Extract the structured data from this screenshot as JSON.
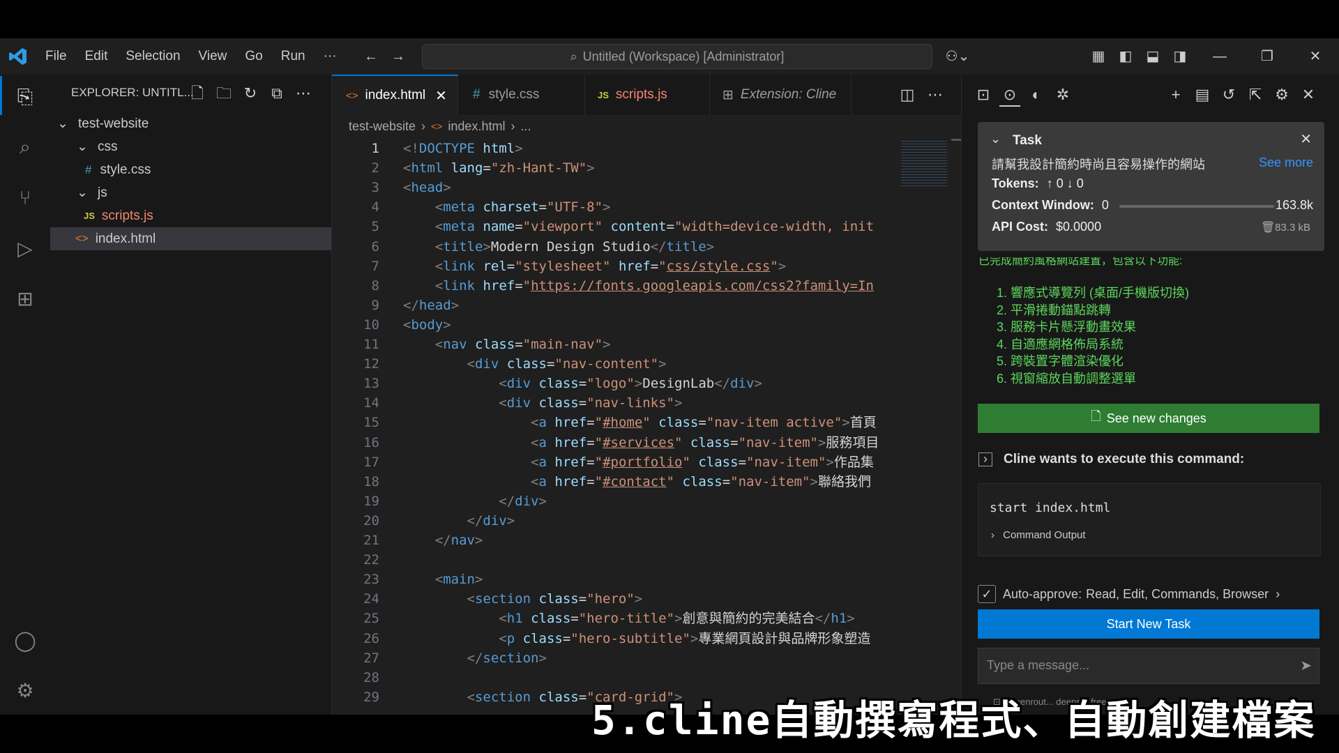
{
  "menu": [
    "File",
    "Edit",
    "Selection",
    "View",
    "Go",
    "Run",
    "···"
  ],
  "command_center": "Untitled (Workspace) [Administrator]",
  "explorer": {
    "title": "EXPLORER: UNTITL...",
    "tree": [
      {
        "label": "test-website",
        "kind": "folder"
      },
      {
        "label": "css",
        "kind": "folder"
      },
      {
        "label": "style.css",
        "kind": "css"
      },
      {
        "label": "js",
        "kind": "folder"
      },
      {
        "label": "scripts.js",
        "kind": "js"
      },
      {
        "label": "index.html",
        "kind": "html"
      }
    ]
  },
  "tabs": [
    {
      "label": "index.html",
      "active": true
    },
    {
      "label": "style.css"
    },
    {
      "label": "scripts.js"
    },
    {
      "label": "Extension: Cline"
    }
  ],
  "breadcrumb": {
    "folder": "test-website",
    "file": "index.html",
    "rest": "..."
  },
  "code": [
    [
      {
        "c": "tg",
        "t": "<!"
      },
      {
        "c": "tn",
        "t": "DOCTYPE"
      },
      {
        "c": "tx",
        "t": " "
      },
      {
        "c": "at",
        "t": "html"
      },
      {
        "c": "tg",
        "t": ">"
      }
    ],
    [
      {
        "c": "tg",
        "t": "<"
      },
      {
        "c": "tn",
        "t": "html"
      },
      {
        "c": "tx",
        "t": " "
      },
      {
        "c": "at",
        "t": "lang"
      },
      {
        "c": "tx",
        "t": "="
      },
      {
        "c": "st",
        "t": "\"zh-Hant-TW\""
      },
      {
        "c": "tg",
        "t": ">"
      }
    ],
    [
      {
        "c": "tg",
        "t": "<"
      },
      {
        "c": "tn",
        "t": "head"
      },
      {
        "c": "tg",
        "t": ">"
      }
    ],
    [
      {
        "c": "tx",
        "t": "    "
      },
      {
        "c": "tg",
        "t": "<"
      },
      {
        "c": "tn",
        "t": "meta"
      },
      {
        "c": "tx",
        "t": " "
      },
      {
        "c": "at",
        "t": "charset"
      },
      {
        "c": "tx",
        "t": "="
      },
      {
        "c": "st",
        "t": "\"UTF-8\""
      },
      {
        "c": "tg",
        "t": ">"
      }
    ],
    [
      {
        "c": "tx",
        "t": "    "
      },
      {
        "c": "tg",
        "t": "<"
      },
      {
        "c": "tn",
        "t": "meta"
      },
      {
        "c": "tx",
        "t": " "
      },
      {
        "c": "at",
        "t": "name"
      },
      {
        "c": "tx",
        "t": "="
      },
      {
        "c": "st",
        "t": "\"viewport\""
      },
      {
        "c": "tx",
        "t": " "
      },
      {
        "c": "at",
        "t": "content"
      },
      {
        "c": "tx",
        "t": "="
      },
      {
        "c": "st",
        "t": "\"width=device-width, init"
      }
    ],
    [
      {
        "c": "tx",
        "t": "    "
      },
      {
        "c": "tg",
        "t": "<"
      },
      {
        "c": "tn",
        "t": "title"
      },
      {
        "c": "tg",
        "t": ">"
      },
      {
        "c": "tx",
        "t": "Modern Design Studio"
      },
      {
        "c": "tg",
        "t": "</"
      },
      {
        "c": "tn",
        "t": "title"
      },
      {
        "c": "tg",
        "t": ">"
      }
    ],
    [
      {
        "c": "tx",
        "t": "    "
      },
      {
        "c": "tg",
        "t": "<"
      },
      {
        "c": "tn",
        "t": "link"
      },
      {
        "c": "tx",
        "t": " "
      },
      {
        "c": "at",
        "t": "rel"
      },
      {
        "c": "tx",
        "t": "="
      },
      {
        "c": "st",
        "t": "\"stylesheet\""
      },
      {
        "c": "tx",
        "t": " "
      },
      {
        "c": "at",
        "t": "href"
      },
      {
        "c": "tx",
        "t": "="
      },
      {
        "c": "st",
        "t": "\""
      },
      {
        "c": "st ul",
        "t": "css/style.css"
      },
      {
        "c": "st",
        "t": "\""
      },
      {
        "c": "tg",
        "t": ">"
      }
    ],
    [
      {
        "c": "tx",
        "t": "    "
      },
      {
        "c": "tg",
        "t": "<"
      },
      {
        "c": "tn",
        "t": "link"
      },
      {
        "c": "tx",
        "t": " "
      },
      {
        "c": "at",
        "t": "href"
      },
      {
        "c": "tx",
        "t": "="
      },
      {
        "c": "st",
        "t": "\""
      },
      {
        "c": "st ul",
        "t": "https://fonts.googleapis.com/css2?family=In"
      }
    ],
    [
      {
        "c": "tg",
        "t": "</"
      },
      {
        "c": "tn",
        "t": "head"
      },
      {
        "c": "tg",
        "t": ">"
      }
    ],
    [
      {
        "c": "tg",
        "t": "<"
      },
      {
        "c": "tn",
        "t": "body"
      },
      {
        "c": "tg",
        "t": ">"
      }
    ],
    [
      {
        "c": "tx",
        "t": "    "
      },
      {
        "c": "tg",
        "t": "<"
      },
      {
        "c": "tn",
        "t": "nav"
      },
      {
        "c": "tx",
        "t": " "
      },
      {
        "c": "at",
        "t": "class"
      },
      {
        "c": "tx",
        "t": "="
      },
      {
        "c": "st",
        "t": "\"main-nav\""
      },
      {
        "c": "tg",
        "t": ">"
      }
    ],
    [
      {
        "c": "tx",
        "t": "        "
      },
      {
        "c": "tg",
        "t": "<"
      },
      {
        "c": "tn",
        "t": "div"
      },
      {
        "c": "tx",
        "t": " "
      },
      {
        "c": "at",
        "t": "class"
      },
      {
        "c": "tx",
        "t": "="
      },
      {
        "c": "st",
        "t": "\"nav-content\""
      },
      {
        "c": "tg",
        "t": ">"
      }
    ],
    [
      {
        "c": "tx",
        "t": "            "
      },
      {
        "c": "tg",
        "t": "<"
      },
      {
        "c": "tn",
        "t": "div"
      },
      {
        "c": "tx",
        "t": " "
      },
      {
        "c": "at",
        "t": "class"
      },
      {
        "c": "tx",
        "t": "="
      },
      {
        "c": "st",
        "t": "\"logo\""
      },
      {
        "c": "tg",
        "t": ">"
      },
      {
        "c": "tx",
        "t": "DesignLab"
      },
      {
        "c": "tg",
        "t": "</"
      },
      {
        "c": "tn",
        "t": "div"
      },
      {
        "c": "tg",
        "t": ">"
      }
    ],
    [
      {
        "c": "tx",
        "t": "            "
      },
      {
        "c": "tg",
        "t": "<"
      },
      {
        "c": "tn",
        "t": "div"
      },
      {
        "c": "tx",
        "t": " "
      },
      {
        "c": "at",
        "t": "class"
      },
      {
        "c": "tx",
        "t": "="
      },
      {
        "c": "st",
        "t": "\"nav-links\""
      },
      {
        "c": "tg",
        "t": ">"
      }
    ],
    [
      {
        "c": "tx",
        "t": "                "
      },
      {
        "c": "tg",
        "t": "<"
      },
      {
        "c": "tn",
        "t": "a"
      },
      {
        "c": "tx",
        "t": " "
      },
      {
        "c": "at",
        "t": "href"
      },
      {
        "c": "tx",
        "t": "="
      },
      {
        "c": "st",
        "t": "\""
      },
      {
        "c": "st ul",
        "t": "#home"
      },
      {
        "c": "st",
        "t": "\""
      },
      {
        "c": "tx",
        "t": " "
      },
      {
        "c": "at",
        "t": "class"
      },
      {
        "c": "tx",
        "t": "="
      },
      {
        "c": "st",
        "t": "\"nav-item active\""
      },
      {
        "c": "tg",
        "t": ">"
      },
      {
        "c": "tx",
        "t": "首頁"
      }
    ],
    [
      {
        "c": "tx",
        "t": "                "
      },
      {
        "c": "tg",
        "t": "<"
      },
      {
        "c": "tn",
        "t": "a"
      },
      {
        "c": "tx",
        "t": " "
      },
      {
        "c": "at",
        "t": "href"
      },
      {
        "c": "tx",
        "t": "="
      },
      {
        "c": "st",
        "t": "\""
      },
      {
        "c": "st ul",
        "t": "#services"
      },
      {
        "c": "st",
        "t": "\""
      },
      {
        "c": "tx",
        "t": " "
      },
      {
        "c": "at",
        "t": "class"
      },
      {
        "c": "tx",
        "t": "="
      },
      {
        "c": "st",
        "t": "\"nav-item\""
      },
      {
        "c": "tg",
        "t": ">"
      },
      {
        "c": "tx",
        "t": "服務項目"
      }
    ],
    [
      {
        "c": "tx",
        "t": "                "
      },
      {
        "c": "tg",
        "t": "<"
      },
      {
        "c": "tn",
        "t": "a"
      },
      {
        "c": "tx",
        "t": " "
      },
      {
        "c": "at",
        "t": "href"
      },
      {
        "c": "tx",
        "t": "="
      },
      {
        "c": "st",
        "t": "\""
      },
      {
        "c": "st ul",
        "t": "#portfolio"
      },
      {
        "c": "st",
        "t": "\""
      },
      {
        "c": "tx",
        "t": " "
      },
      {
        "c": "at",
        "t": "class"
      },
      {
        "c": "tx",
        "t": "="
      },
      {
        "c": "st",
        "t": "\"nav-item\""
      },
      {
        "c": "tg",
        "t": ">"
      },
      {
        "c": "tx",
        "t": "作品集"
      }
    ],
    [
      {
        "c": "tx",
        "t": "                "
      },
      {
        "c": "tg",
        "t": "<"
      },
      {
        "c": "tn",
        "t": "a"
      },
      {
        "c": "tx",
        "t": " "
      },
      {
        "c": "at",
        "t": "href"
      },
      {
        "c": "tx",
        "t": "="
      },
      {
        "c": "st",
        "t": "\""
      },
      {
        "c": "st ul",
        "t": "#contact"
      },
      {
        "c": "st",
        "t": "\""
      },
      {
        "c": "tx",
        "t": " "
      },
      {
        "c": "at",
        "t": "class"
      },
      {
        "c": "tx",
        "t": "="
      },
      {
        "c": "st",
        "t": "\"nav-item\""
      },
      {
        "c": "tg",
        "t": ">"
      },
      {
        "c": "tx",
        "t": "聯絡我們"
      }
    ],
    [
      {
        "c": "tx",
        "t": "            "
      },
      {
        "c": "tg",
        "t": "</"
      },
      {
        "c": "tn",
        "t": "div"
      },
      {
        "c": "tg",
        "t": ">"
      }
    ],
    [
      {
        "c": "tx",
        "t": "        "
      },
      {
        "c": "tg",
        "t": "</"
      },
      {
        "c": "tn",
        "t": "div"
      },
      {
        "c": "tg",
        "t": ">"
      }
    ],
    [
      {
        "c": "tx",
        "t": "    "
      },
      {
        "c": "tg",
        "t": "</"
      },
      {
        "c": "tn",
        "t": "nav"
      },
      {
        "c": "tg",
        "t": ">"
      }
    ],
    [],
    [
      {
        "c": "tx",
        "t": "    "
      },
      {
        "c": "tg",
        "t": "<"
      },
      {
        "c": "tn",
        "t": "main"
      },
      {
        "c": "tg",
        "t": ">"
      }
    ],
    [
      {
        "c": "tx",
        "t": "        "
      },
      {
        "c": "tg",
        "t": "<"
      },
      {
        "c": "tn",
        "t": "section"
      },
      {
        "c": "tx",
        "t": " "
      },
      {
        "c": "at",
        "t": "class"
      },
      {
        "c": "tx",
        "t": "="
      },
      {
        "c": "st",
        "t": "\"hero\""
      },
      {
        "c": "tg",
        "t": ">"
      }
    ],
    [
      {
        "c": "tx",
        "t": "            "
      },
      {
        "c": "tg",
        "t": "<"
      },
      {
        "c": "tn",
        "t": "h1"
      },
      {
        "c": "tx",
        "t": " "
      },
      {
        "c": "at",
        "t": "class"
      },
      {
        "c": "tx",
        "t": "="
      },
      {
        "c": "st",
        "t": "\"hero-title\""
      },
      {
        "c": "tg",
        "t": ">"
      },
      {
        "c": "tx",
        "t": "創意與簡約的完美結合"
      },
      {
        "c": "tg",
        "t": "</"
      },
      {
        "c": "tn",
        "t": "h1"
      },
      {
        "c": "tg",
        "t": ">"
      }
    ],
    [
      {
        "c": "tx",
        "t": "            "
      },
      {
        "c": "tg",
        "t": "<"
      },
      {
        "c": "tn",
        "t": "p"
      },
      {
        "c": "tx",
        "t": " "
      },
      {
        "c": "at",
        "t": "class"
      },
      {
        "c": "tx",
        "t": "="
      },
      {
        "c": "st",
        "t": "\"hero-subtitle\""
      },
      {
        "c": "tg",
        "t": ">"
      },
      {
        "c": "tx",
        "t": "專業網頁設計與品牌形象塑造"
      }
    ],
    [
      {
        "c": "tx",
        "t": "        "
      },
      {
        "c": "tg",
        "t": "</"
      },
      {
        "c": "tn",
        "t": "section"
      },
      {
        "c": "tg",
        "t": ">"
      }
    ],
    [],
    [
      {
        "c": "tx",
        "t": "        "
      },
      {
        "c": "tg",
        "t": "<"
      },
      {
        "c": "tn",
        "t": "section"
      },
      {
        "c": "tx",
        "t": " "
      },
      {
        "c": "at",
        "t": "class"
      },
      {
        "c": "tx",
        "t": "="
      },
      {
        "c": "st",
        "t": "\"card-grid\""
      },
      {
        "c": "tg",
        "t": ">"
      }
    ]
  ],
  "cline": {
    "task_label": "Task",
    "task_text": "請幫我設計簡約時尚且容易操作的網站",
    "see_more": "See more",
    "tokens_label": "Tokens:",
    "tokens_value": "↑ 0 ↓ 0",
    "context_label": "Context Window:",
    "context_used": "0",
    "context_max": "163.8k",
    "api_cost_label": "API Cost:",
    "api_cost_value": "$0.0000",
    "size": "83.3 kB",
    "partial_line": "已完成簡約風格網站建置，包含以下功能:",
    "features": [
      "響應式導覽列 (桌面/手機版切換)",
      "平滑捲動錨點跳轉",
      "服務卡片懸浮動畫效果",
      "自適應網格佈局系統",
      "跨裝置字體渲染優化",
      "視窗縮放自動調整選單"
    ],
    "see_new_changes": "See new changes",
    "execute_title": "Cline wants to execute this command:",
    "command": "start index.html",
    "command_output": "Command Output",
    "auto_approve_label": "Auto-approve:",
    "auto_approve_value": "Read, Edit, Commands, Browser",
    "start_new_task": "Start New Task",
    "message_placeholder": "Type a message...",
    "model_hint": "openrout... deeps... free"
  },
  "caption": "5.cline自動撰寫程式、自動創建檔案",
  "colors": {
    "accent_blue": "#0078d4",
    "green_button": "#2e7d32",
    "feature_green": "#5cd65c"
  }
}
